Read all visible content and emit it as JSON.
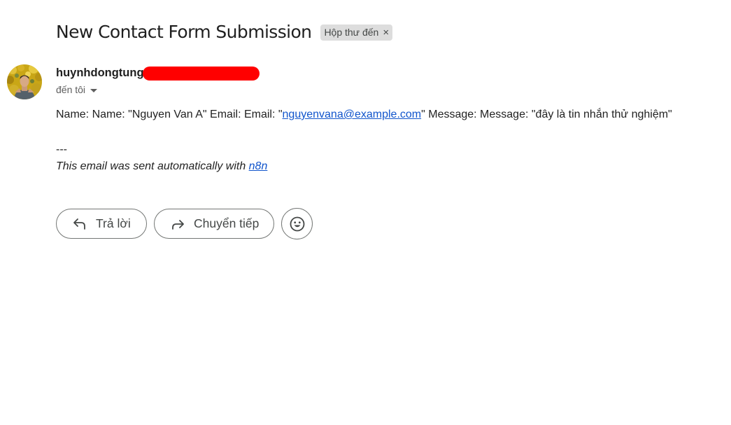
{
  "email": {
    "subject": "New Contact Form Submission",
    "label": "Hộp thư đến",
    "label_close": "×",
    "sender_name": "huynhdongtung",
    "recipient": "đến tôi",
    "body": {
      "part1": "Name: Name: \"Nguyen Van A\" Email: Email: \"",
      "email_link": "nguyenvana@example.com",
      "part2": "\" Message: Message: \"đây là tin nhắn thử nghiệm\""
    },
    "divider": "---",
    "signature": {
      "text": "This email was sent automatically with ",
      "link": "n8n"
    }
  },
  "actions": {
    "reply_label": "Trả lời",
    "forward_label": "Chuyển tiếp"
  },
  "icons": {
    "avatar": "avatar-photo",
    "reply": "reply-icon",
    "forward": "forward-icon",
    "emoji": "emoji-icon",
    "caret": "caret-down-icon"
  },
  "colors": {
    "link": "#1155cc",
    "redaction": "#ff0000",
    "chip_bg": "#dddddd",
    "button_border": "#747775"
  }
}
